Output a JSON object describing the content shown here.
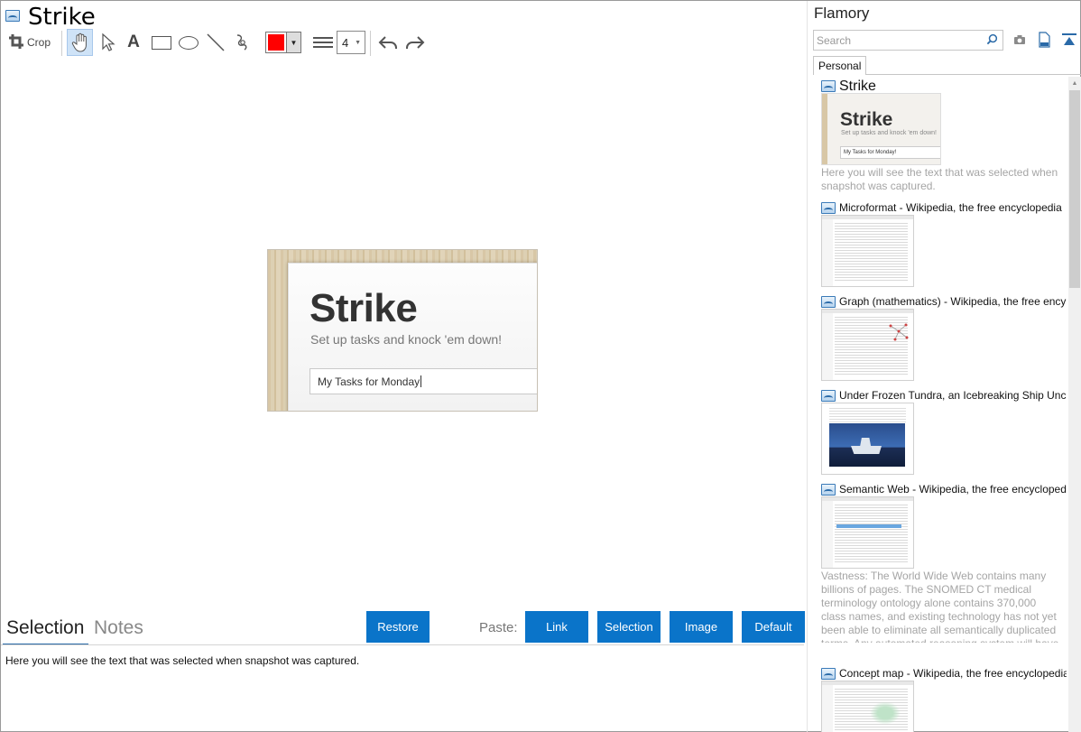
{
  "window": {
    "title": "Strike"
  },
  "toolbar": {
    "crop_label": "Crop",
    "stroke_width": "4",
    "color": "#ff0000",
    "icons": [
      "crop-icon",
      "hand-icon",
      "pointer-icon",
      "text-icon",
      "rectangle-icon",
      "ellipse-icon",
      "line-icon",
      "freehand-icon",
      "color-picker",
      "line-width-icon",
      "undo-icon",
      "redo-icon"
    ]
  },
  "snapshot": {
    "title": "Strike",
    "subtitle": "Set up tasks and knock 'em down!",
    "input_value": "My Tasks for Monday"
  },
  "bottom": {
    "tabs": [
      "Selection",
      "Notes"
    ],
    "restore_label": "Restore",
    "paste_label": "Paste:",
    "paste_buttons": [
      "Link",
      "Selection",
      "Image",
      "Default"
    ],
    "selection_text": "Here you will see the text that was selected when snapshot was captured.",
    "accent": "#0a74c9"
  },
  "sidebar": {
    "title": "Flamory",
    "search_placeholder": "Search",
    "tab": "Personal",
    "items": [
      {
        "title": "Strike",
        "thumb_title": "Strike",
        "thumb_sub": "Set up tasks and knock 'em down!",
        "thumb_input": "My Tasks for Monday!",
        "desc": "Here you will see the text that was selected when snapshot was captured."
      },
      {
        "title": "Microformat - Wikipedia, the free encyclopedia"
      },
      {
        "title": "Graph (mathematics) - Wikipedia, the free ency"
      },
      {
        "title": "Under Frozen Tundra, an Icebreaking Ship Unco"
      },
      {
        "title": "Semantic Web - Wikipedia, the free encycloped",
        "desc": "Vastness: The World Wide Web contains many billions of pages. The SNOMED CT medical terminology ontology alone contains 370,000 class names, and existing technology has not yet been able to eliminate all semantically duplicated terms. Any automated reasoning system will have to deal with truly huge inputs."
      },
      {
        "title": "Concept map - Wikipedia, the free encyclopedia"
      }
    ]
  }
}
